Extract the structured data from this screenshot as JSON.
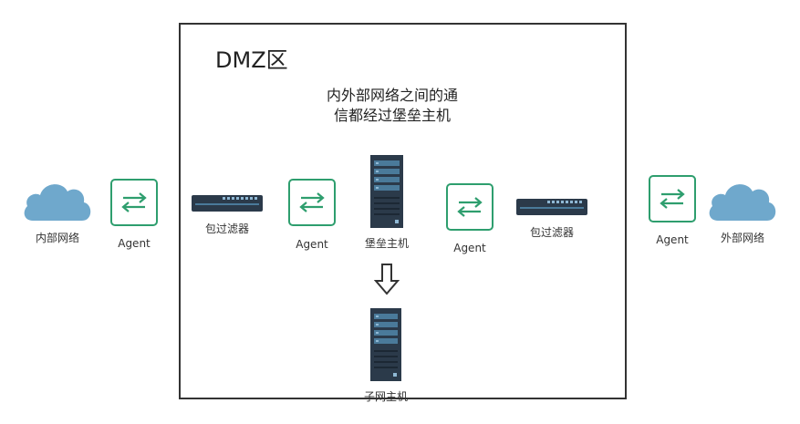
{
  "dmz": {
    "title": "DMZ区",
    "description_line1": "内外部网络之间的通",
    "description_line2": "信都经过堡垒主机"
  },
  "nodes": {
    "internal_network": "内部网络",
    "external_network": "外部网络",
    "agent_left": "Agent",
    "agent_inner_left": "Agent",
    "agent_inner_right": "Agent",
    "agent_right": "Agent",
    "packet_filter_left": "包过滤器",
    "packet_filter_right": "包过滤器",
    "bastion_host": "堡垒主机",
    "subnet_host": "子网主机"
  },
  "colors": {
    "cloud": "#6fa8cc",
    "agent_border": "#2e9e6e",
    "server": "#2b3a4a",
    "server_light": "#4a7a9a"
  },
  "icons": [
    "cloud-icon",
    "agent-exchange-icon",
    "switch-icon",
    "server-icon",
    "down-arrow-icon"
  ]
}
